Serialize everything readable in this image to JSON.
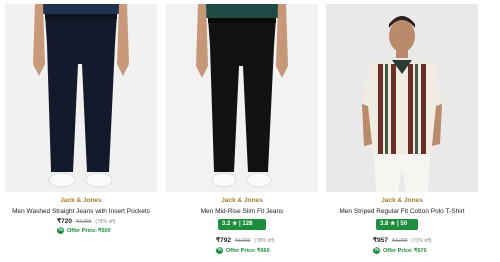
{
  "products": [
    {
      "brand": "Jack & Jones",
      "name": "Men Washed Straight Jeans with Insert Pockets",
      "price": "₹720",
      "mrp": "₹3,999",
      "discount": "(78% off)",
      "offer_label": "Offer Price:",
      "offer_value": "₹600",
      "image_icon": "jeans-model-photo"
    },
    {
      "brand": "Jack & Jones",
      "name": "Men Mid-Rise Slim Fit Jeans",
      "rating": "3.2 ★ | 128",
      "price": "₹792",
      "mrp": "₹3,999",
      "discount": "(78% off)",
      "offer_label": "Offer Price:",
      "offer_value": "₹660",
      "image_icon": "jeans-model-photo"
    },
    {
      "brand": "Jack & Jones",
      "name": "Men Striped Regular Fit Cotton Polo T-Shirt",
      "rating": "3.8 ★ | 50",
      "price": "₹957",
      "mrp": "₹3,299",
      "discount": "(71% off)",
      "offer_label": "Offer Price:",
      "offer_value": "₹670",
      "image_icon": "polo-model-photo"
    }
  ],
  "colors": {
    "brand": "#a67c2c",
    "rating_bg": "#1e8e3e",
    "offer": "#1e8e3e"
  }
}
